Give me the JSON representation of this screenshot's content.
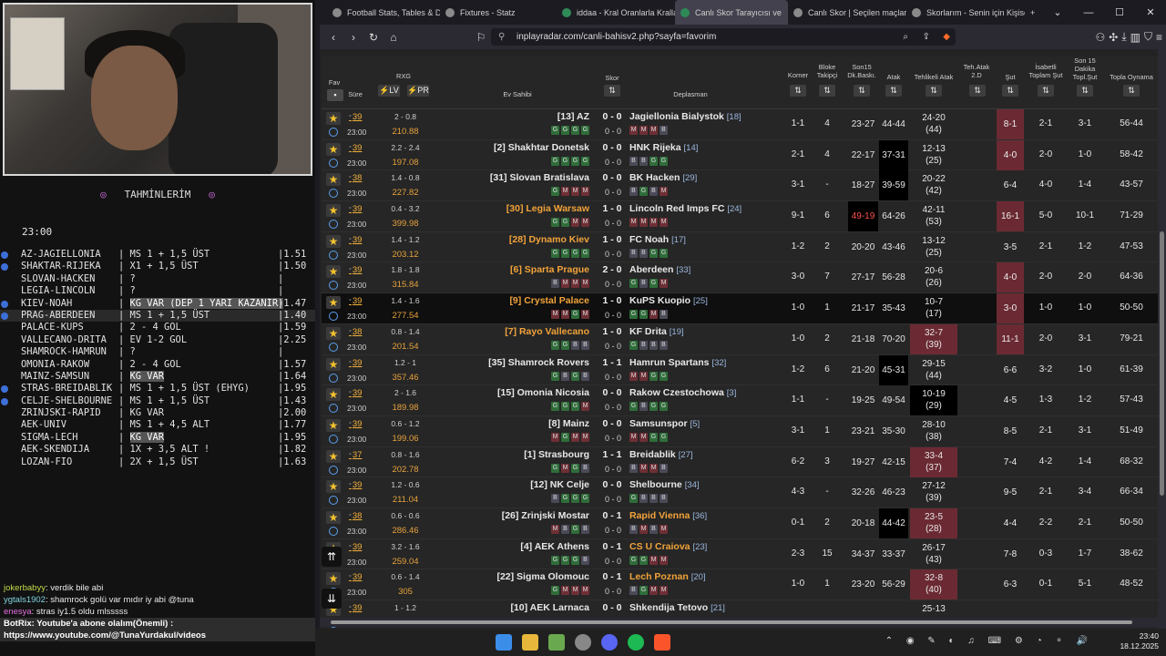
{
  "tahmin": {
    "title": "TAHMİNLERİM",
    "time": "23:00",
    "rows": [
      {
        "b": true,
        "m": "AZ-JAGIELLONIA",
        "p": "MS 1 + 1,5 ÜST",
        "o": "1.51"
      },
      {
        "b": true,
        "m": "SHAKTAR-RIJEKA",
        "p": "X1 + 1,5 ÜST",
        "o": "1.50"
      },
      {
        "b": false,
        "m": "SLOVAN-HACKEN",
        "p": "?",
        "o": ""
      },
      {
        "b": false,
        "m": "LEGIA-LINCOLN",
        "p": "?",
        "o": ""
      },
      {
        "b": true,
        "m": "KIEV-NOAH",
        "p": "KG VAR (DEP 1 YARI KAZANIR)",
        "o": "1.47",
        "kg": true
      },
      {
        "b": true,
        "m": "PRAG-ABERDEEN",
        "p": "MS 1 + 1,5 ÜST",
        "o": "1.40",
        "hl": true
      },
      {
        "b": false,
        "m": "PALACE-KUPS",
        "p": "2 - 4 GOL",
        "o": "1.59"
      },
      {
        "b": false,
        "m": "VALLECANO-DRITA",
        "p": "EV 1-2 GOL",
        "o": "2.25"
      },
      {
        "b": false,
        "m": "SHAMROCK-HAMRUN",
        "p": "?",
        "o": ""
      },
      {
        "b": false,
        "m": "OMONIA-RAKOW",
        "p": "2 - 4 GOL",
        "o": "1.57"
      },
      {
        "b": false,
        "m": "MAINZ-SAMSUN",
        "p": "KG VAR",
        "o": "1.64",
        "kg": true
      },
      {
        "b": true,
        "m": "STRAS-BREIDABLIK",
        "p": "MS 1 + 1,5 ÜST (EHYG)",
        "o": "1.95"
      },
      {
        "b": true,
        "m": "CELJE-SHELBOURNE",
        "p": "MS 1 + 1,5 ÜST",
        "o": "1.43"
      },
      {
        "b": false,
        "m": "ZRINJSKI-RAPID",
        "p": "KG VAR",
        "o": "2.00"
      },
      {
        "b": false,
        "m": "AEK-UNIV",
        "p": "MS 1 + 4,5 ALT",
        "o": "1.77"
      },
      {
        "b": false,
        "m": "SIGMA-LECH",
        "p": "KG VAR",
        "o": "1.95",
        "kg": true
      },
      {
        "b": false,
        "m": "AEK-SKENDIJA",
        "p": "1X + 3,5 ALT !",
        "o": "1.82"
      },
      {
        "b": false,
        "m": "LOZAN-FIO",
        "p": "2X + 1,5 ÜST",
        "o": "1.63"
      }
    ]
  },
  "chat": {
    "m1_user": "jokerbabyy",
    "m1_text": ": verdik bile abi",
    "m2_user": "ygtals1902",
    "m2_text": ": shamrock golü var mıdır iy abi @tuna",
    "m3_user": "enesya",
    "m3_text": ": stras iy1.5 oldu mlsssss",
    "m4_user": "BotRix",
    "m4_text": ": Youtube'a abone olalım(Önemli) :",
    "m5_text": "https://www.youtube.com/@TunaYurdakul/videos"
  },
  "browser": {
    "tabs": [
      "Football Stats, Tables & Dat",
      "Fixtures - Statz",
      "iddaa - Kral Oranlarla Kralla",
      "Canlı Skor Tarayıcısı ve",
      "Canlı Skor | Seçilen maçlar",
      "Skorlarım - Senin için Kişise"
    ],
    "url": "inplayradar.com/canli-bahisv2.php?sayfa=favorim"
  },
  "headers": {
    "fav": "Fav",
    "sure": "Süre",
    "rxg": "RXG",
    "lv": "⚡LV",
    "pr": "⚡PR",
    "ev": "Ev Sahibi",
    "skor": "Skor",
    "dep": "Deplasman",
    "korner": "Korner",
    "blok": "Bloke Takipçi",
    "son15": "Son15 Dk.Baskı.",
    "atak": "Atak",
    "tehlike": "Tehlikeli Atak",
    "tehatak": "Teh.Atak 2.D",
    "sut": "Şut",
    "isabet": "İsabetli Toplam Şut",
    "son15sut": "Son 15 Dakika Topl.Şut",
    "topla": "Topla Oynama"
  },
  "matches": [
    {
      "min": "39",
      "time": "23:00",
      "rxg": "2 - 0.8",
      "rxv": "210.88",
      "home": "[13] AZ",
      "away": "Jagiellonia Bialystok",
      "arank": "[18]",
      "score": "0 - 0",
      "s0": "0 - 0",
      "k": "1-1",
      "b": "4",
      "d": "23-27",
      "a": "44-44",
      "t1": "24-20",
      "t2": "(44)",
      "s": "8-1",
      "sr": true,
      "i": "2-1",
      "l": "3-1",
      "p": "56-44",
      "fh": "GGGG",
      "fa": "MMMB"
    },
    {
      "min": "39",
      "time": "23:00",
      "rxg": "2.2 - 2.4",
      "rxv": "197.08",
      "home": "[2] Shakhtar Donetsk",
      "away": "HNK Rijeka",
      "arank": "[14]",
      "score": "0 - 0",
      "s0": "0 - 0",
      "k": "2-1",
      "b": "4",
      "d": "22-17",
      "a": "37-31",
      "ab": true,
      "t1": "12-13",
      "t2": "(25)",
      "s": "4-0",
      "sr": true,
      "i": "2-0",
      "l": "1-0",
      "p": "58-42",
      "fh": "GGGG",
      "fa": "BBGG"
    },
    {
      "min": "38",
      "time": "23:00",
      "rxg": "1.4 - 0.8",
      "rxv": "227.82",
      "home": "[31] Slovan Bratislava",
      "away": "BK Hacken",
      "arank": "[29]",
      "score": "0 - 0",
      "s0": "0 - 0",
      "k": "3-1",
      "b": "-",
      "d": "18-27",
      "a": "39-59",
      "ab": true,
      "t1": "20-22",
      "t2": "(42)",
      "s": "6-4",
      "i": "4-0",
      "l": "1-4",
      "p": "43-57",
      "fh": "GMMM",
      "fa": "BGBM"
    },
    {
      "min": "39",
      "time": "23:00",
      "rxg": "0.4 - 3.2",
      "rxv": "399.98",
      "home": "[30] Legia Warsaw",
      "ho": true,
      "away": "Lincoln Red Imps FC",
      "arank": "[24]",
      "score": "1 - 0",
      "s0": "0 - 0",
      "k": "9-1",
      "b": "6",
      "d": "49-19",
      "dr": true,
      "a": "64-26",
      "t1": "42-11",
      "t2": "(53)",
      "s": "16-1",
      "sr": true,
      "i": "5-0",
      "l": "10-1",
      "p": "71-29",
      "fh": "GGMM",
      "fa": "MMMM"
    },
    {
      "min": "39",
      "time": "23:00",
      "rxg": "1.4 - 1.2",
      "rxv": "203.12",
      "home": "[28] Dynamo Kiev",
      "ho": true,
      "away": "FC Noah",
      "arank": "[17]",
      "score": "1 - 0",
      "s0": "0 - 0",
      "k": "1-2",
      "b": "2",
      "d": "20-20",
      "a": "43-46",
      "t1": "13-12",
      "t2": "(25)",
      "s": "3-5",
      "i": "2-1",
      "l": "1-2",
      "p": "47-53",
      "fh": "GGGG",
      "fa": "BBGG"
    },
    {
      "min": "39",
      "time": "23:00",
      "rxg": "1.8 - 1.8",
      "rxv": "315.84",
      "home": "[6] Sparta Prague",
      "ho": true,
      "away": "Aberdeen",
      "arank": "[33]",
      "score": "2 - 0",
      "s0": "0 - 0",
      "k": "3-0",
      "b": "7",
      "d": "27-17",
      "a": "56-28",
      "t1": "20-6",
      "t2": "(26)",
      "s": "4-0",
      "sr": true,
      "i": "2-0",
      "l": "2-0",
      "p": "64-36",
      "fh": "BMMM",
      "fa": "GBGM"
    },
    {
      "min": "39",
      "time": "23:00",
      "rxg": "1.4 - 1.6",
      "rxv": "277.54",
      "home": "[9] Crystal Palace",
      "ho": true,
      "away": "KuPS Kuopio",
      "arank": "[25]",
      "score": "1 - 0",
      "s0": "0 - 0",
      "k": "1-0",
      "b": "1",
      "d": "21-17",
      "a": "35-43",
      "t1": "10-7",
      "t2": "(17)",
      "s": "3-0",
      "sr": true,
      "i": "1-0",
      "l": "1-0",
      "p": "50-50",
      "fh": "MMGM",
      "fa": "GGMB",
      "dark": true
    },
    {
      "min": "38",
      "time": "23:00",
      "rxg": "0.8 - 1.4",
      "rxv": "201.54",
      "home": "[7] Rayo Vallecano",
      "ho": true,
      "away": "KF Drita",
      "arank": "[19]",
      "score": "1 - 0",
      "s0": "0 - 0",
      "k": "1-0",
      "b": "2",
      "d": "21-18",
      "a": "70-20",
      "t1": "32-7",
      "t2": "(39)",
      "tr": true,
      "s": "11-1",
      "sr": true,
      "i": "2-0",
      "l": "3-1",
      "p": "79-21",
      "fh": "GGBB",
      "fa": "GBBB"
    },
    {
      "min": "39",
      "time": "23:00",
      "rxg": "1.2 - 1",
      "rxv": "357.46",
      "home": "[35] Shamrock Rovers",
      "away": "Hamrun Spartans",
      "arank": "[32]",
      "score": "1 - 1",
      "s0": "0 - 0",
      "k": "1-2",
      "b": "6",
      "d": "21-20",
      "a": "45-31",
      "ab": true,
      "t1": "29-15",
      "t2": "(44)",
      "s": "6-6",
      "i": "3-2",
      "l": "1-0",
      "p": "61-39",
      "fh": "GBGB",
      "fa": "MMGG"
    },
    {
      "min": "39",
      "time": "23:00",
      "rxg": "2 - 1.6",
      "rxv": "189.98",
      "home": "[15] Omonia Nicosia",
      "away": "Rakow Czestochowa",
      "arank": "[3]",
      "score": "0 - 0",
      "s0": "0 - 0",
      "k": "1-1",
      "b": "-",
      "d": "19-25",
      "a": "49-54",
      "t1": "10-19",
      "t2": "(29)",
      "tb": true,
      "s": "4-5",
      "i": "1-3",
      "l": "1-2",
      "p": "57-43",
      "fh": "GGGM",
      "fa": "GBGG"
    },
    {
      "min": "39",
      "time": "23:00",
      "rxg": "0.6 - 1.2",
      "rxv": "199.06",
      "home": "[8] Mainz",
      "away": "Samsunspor",
      "arank": "[5]",
      "score": "0 - 0",
      "s0": "0 - 0",
      "k": "3-1",
      "b": "1",
      "d": "23-21",
      "a": "35-30",
      "t1": "28-10",
      "t2": "(38)",
      "s": "8-5",
      "i": "2-1",
      "l": "3-1",
      "p": "51-49",
      "fh": "MGMM",
      "fa": "MMGG"
    },
    {
      "min": "37",
      "time": "23:00",
      "rxg": "0.8 - 1.6",
      "rxv": "202.78",
      "home": "[1] Strasbourg",
      "away": "Breidablik",
      "arank": "[27]",
      "score": "1 - 1",
      "s0": "0 - 0",
      "k": "6-2",
      "b": "3",
      "d": "19-27",
      "a": "42-15",
      "t1": "33-4",
      "t2": "(37)",
      "tr": true,
      "s": "7-4",
      "i": "4-2",
      "l": "1-4",
      "p": "68-32",
      "fh": "GMGB",
      "fa": "BMMB"
    },
    {
      "min": "39",
      "time": "23:00",
      "rxg": "1.2 - 0.6",
      "rxv": "211.04",
      "home": "[12] NK Celje",
      "away": "Shelbourne",
      "arank": "[34]",
      "score": "0 - 0",
      "s0": "0 - 0",
      "k": "4-3",
      "b": "-",
      "d": "32-26",
      "a": "46-23",
      "t1": "27-12",
      "t2": "(39)",
      "s": "9-5",
      "i": "2-1",
      "l": "3-4",
      "p": "66-34",
      "fh": "BGGG",
      "fa": "GBBB"
    },
    {
      "min": "38",
      "time": "23:00",
      "rxg": "0.6 - 0.6",
      "rxv": "286.46",
      "home": "[26] Zrinjski Mostar",
      "away": "Rapid Vienna",
      "ao": true,
      "arank": "[36]",
      "score": "0 - 1",
      "s0": "0 - 0",
      "k": "0-1",
      "b": "2",
      "d": "20-18",
      "a": "44-42",
      "ab": true,
      "t1": "23-5",
      "t2": "(28)",
      "tr": true,
      "s": "4-4",
      "i": "2-2",
      "l": "2-1",
      "p": "50-50",
      "fh": "MBGB",
      "fa": "BMBM"
    },
    {
      "min": "39",
      "time": "23:00",
      "rxg": "3.2 - 1.6",
      "rxv": "259.04",
      "home": "[4] AEK Athens",
      "away": "CS U Craiova",
      "ao": true,
      "arank": "[23]",
      "score": "0 - 1",
      "s0": "0 - 0",
      "k": "2-3",
      "b": "15",
      "d": "34-37",
      "a": "33-37",
      "t1": "26-17",
      "t2": "(43)",
      "s": "7-8",
      "i": "0-3",
      "l": "1-7",
      "p": "38-62",
      "fh": "GGGB",
      "fa": "GGMM"
    },
    {
      "min": "39",
      "time": "23:00",
      "rxg": "0.6 - 1.4",
      "rxv": "305",
      "home": "[22] Sigma Olomouc",
      "away": "Lech Poznan",
      "ao": true,
      "arank": "[20]",
      "score": "0 - 1",
      "s0": "0 - 0",
      "k": "1-0",
      "b": "1",
      "d": "23-20",
      "a": "56-29",
      "t1": "32-8",
      "t2": "(40)",
      "tr": true,
      "s": "6-3",
      "i": "0-1",
      "l": "5-1",
      "p": "48-52",
      "fh": "GMMM",
      "fa": "BGMM"
    },
    {
      "min": "39",
      "time": "",
      "rxg": "1 - 1.2",
      "rxv": "",
      "home": "[10] AEK Larnaca",
      "away": "Shkendija Tetovo",
      "arank": "[21]",
      "score": "0 - 0",
      "s0": "",
      "k": "",
      "b": "",
      "d": "",
      "a": "",
      "t1": "25-13",
      "t2": "",
      "s": "",
      "i": "",
      "l": "",
      "p": "",
      "fh": "",
      "fa": ""
    }
  ],
  "clock": {
    "time": "23:40",
    "date": "18.12.2025"
  }
}
